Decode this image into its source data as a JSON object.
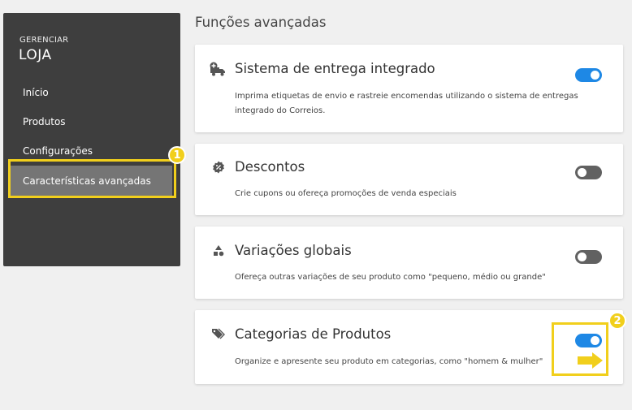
{
  "sidebar": {
    "brand_small": "GERENCIAR",
    "brand_big": "LOJA",
    "items": [
      {
        "label": "Início"
      },
      {
        "label": "Produtos"
      },
      {
        "label": "Configurações"
      },
      {
        "label": "Características avançadas"
      }
    ]
  },
  "main": {
    "section_title": "Funções avançadas",
    "cards": [
      {
        "title": "Sistema de entrega integrado",
        "desc": "Imprima etiquetas de envio e rastreie encomendas utilizando o sistema de entregas integrado do Correios.",
        "icon": "delivery-truck-icon",
        "enabled": true
      },
      {
        "title": "Descontos",
        "desc": "Crie cupons ou ofereça promoções de venda especiais",
        "icon": "discount-badge-icon",
        "enabled": false
      },
      {
        "title": "Variações globais",
        "desc": "Ofereça outras variações de seu produto como \"pequeno, médio ou grande\"",
        "icon": "shapes-icon",
        "enabled": false
      },
      {
        "title": "Categorias de Produtos",
        "desc": "Organize e apresente seu produto em categorias, como \"homem & mulher\"",
        "icon": "tags-icon",
        "enabled": true
      }
    ]
  },
  "annotations": {
    "step1": "1",
    "step2": "2",
    "color": "#f1cf1c"
  },
  "colors": {
    "toggle_on": "#1e88e5",
    "toggle_off": "#616161",
    "sidebar_bg": "#3e3e3e",
    "sidebar_active": "#757575"
  }
}
